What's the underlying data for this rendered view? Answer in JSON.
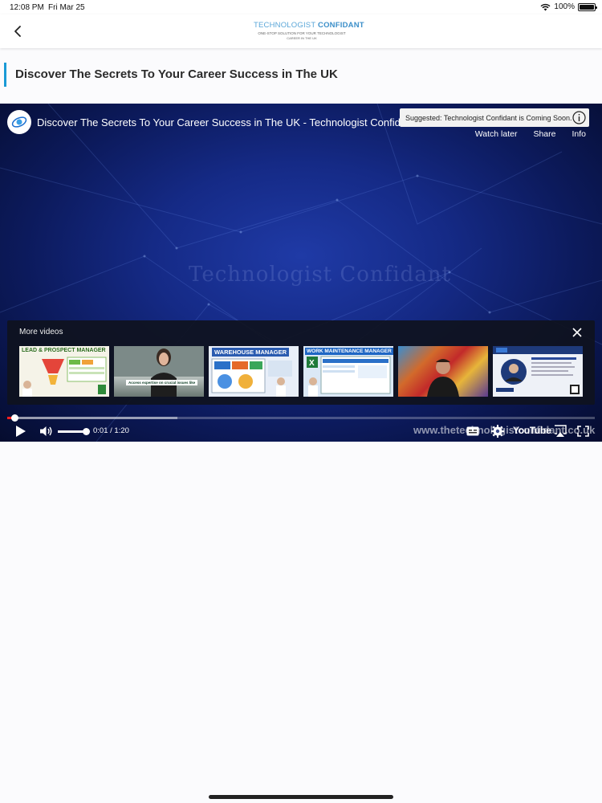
{
  "status_bar": {
    "time": "12:08 PM",
    "date": "Fri Mar 25",
    "battery": "100%"
  },
  "header": {
    "logo_line1_a": "TECHNOLOGIST ",
    "logo_line1_b": "CONFIDANT",
    "logo_line2": "ONE-STOP SOLUTION FOR YOUR TECHNOLOGIST",
    "logo_line3": "CAREER IN THE UK"
  },
  "page": {
    "title": "Discover The Secrets To Your Career Success in The UK"
  },
  "player": {
    "video_title": "Discover The Secrets To Your Career Success in The UK - Technologist Confidant",
    "watermark": "Technologist Confidant",
    "suggestion": "Suggested: Technologist Confidant is Coming Soon.",
    "actions": {
      "watch_later": "Watch later",
      "share": "Share",
      "info": "Info"
    },
    "more_videos": {
      "title": "More videos",
      "thumbs": [
        {
          "label": "LEAD & PROSPECT MANAGER"
        },
        {
          "label": "Access expertise on crucial issues like"
        },
        {
          "label": "WAREHOUSE MANAGER"
        },
        {
          "label": "WORK MAINTENANCE MANAGER"
        },
        {
          "label": ""
        },
        {
          "label": ""
        }
      ]
    },
    "progress": {
      "played_fraction": 0.0125,
      "buffered_fraction": 0.29
    },
    "volume_fraction": 1.0,
    "time": "0:01 / 1:20",
    "site_watermark": "www.thetechnologistconfidant.co.uk",
    "youtube": "YouTube"
  },
  "colors": {
    "accent": "#1a9ad6",
    "progress": "#ff2020"
  }
}
